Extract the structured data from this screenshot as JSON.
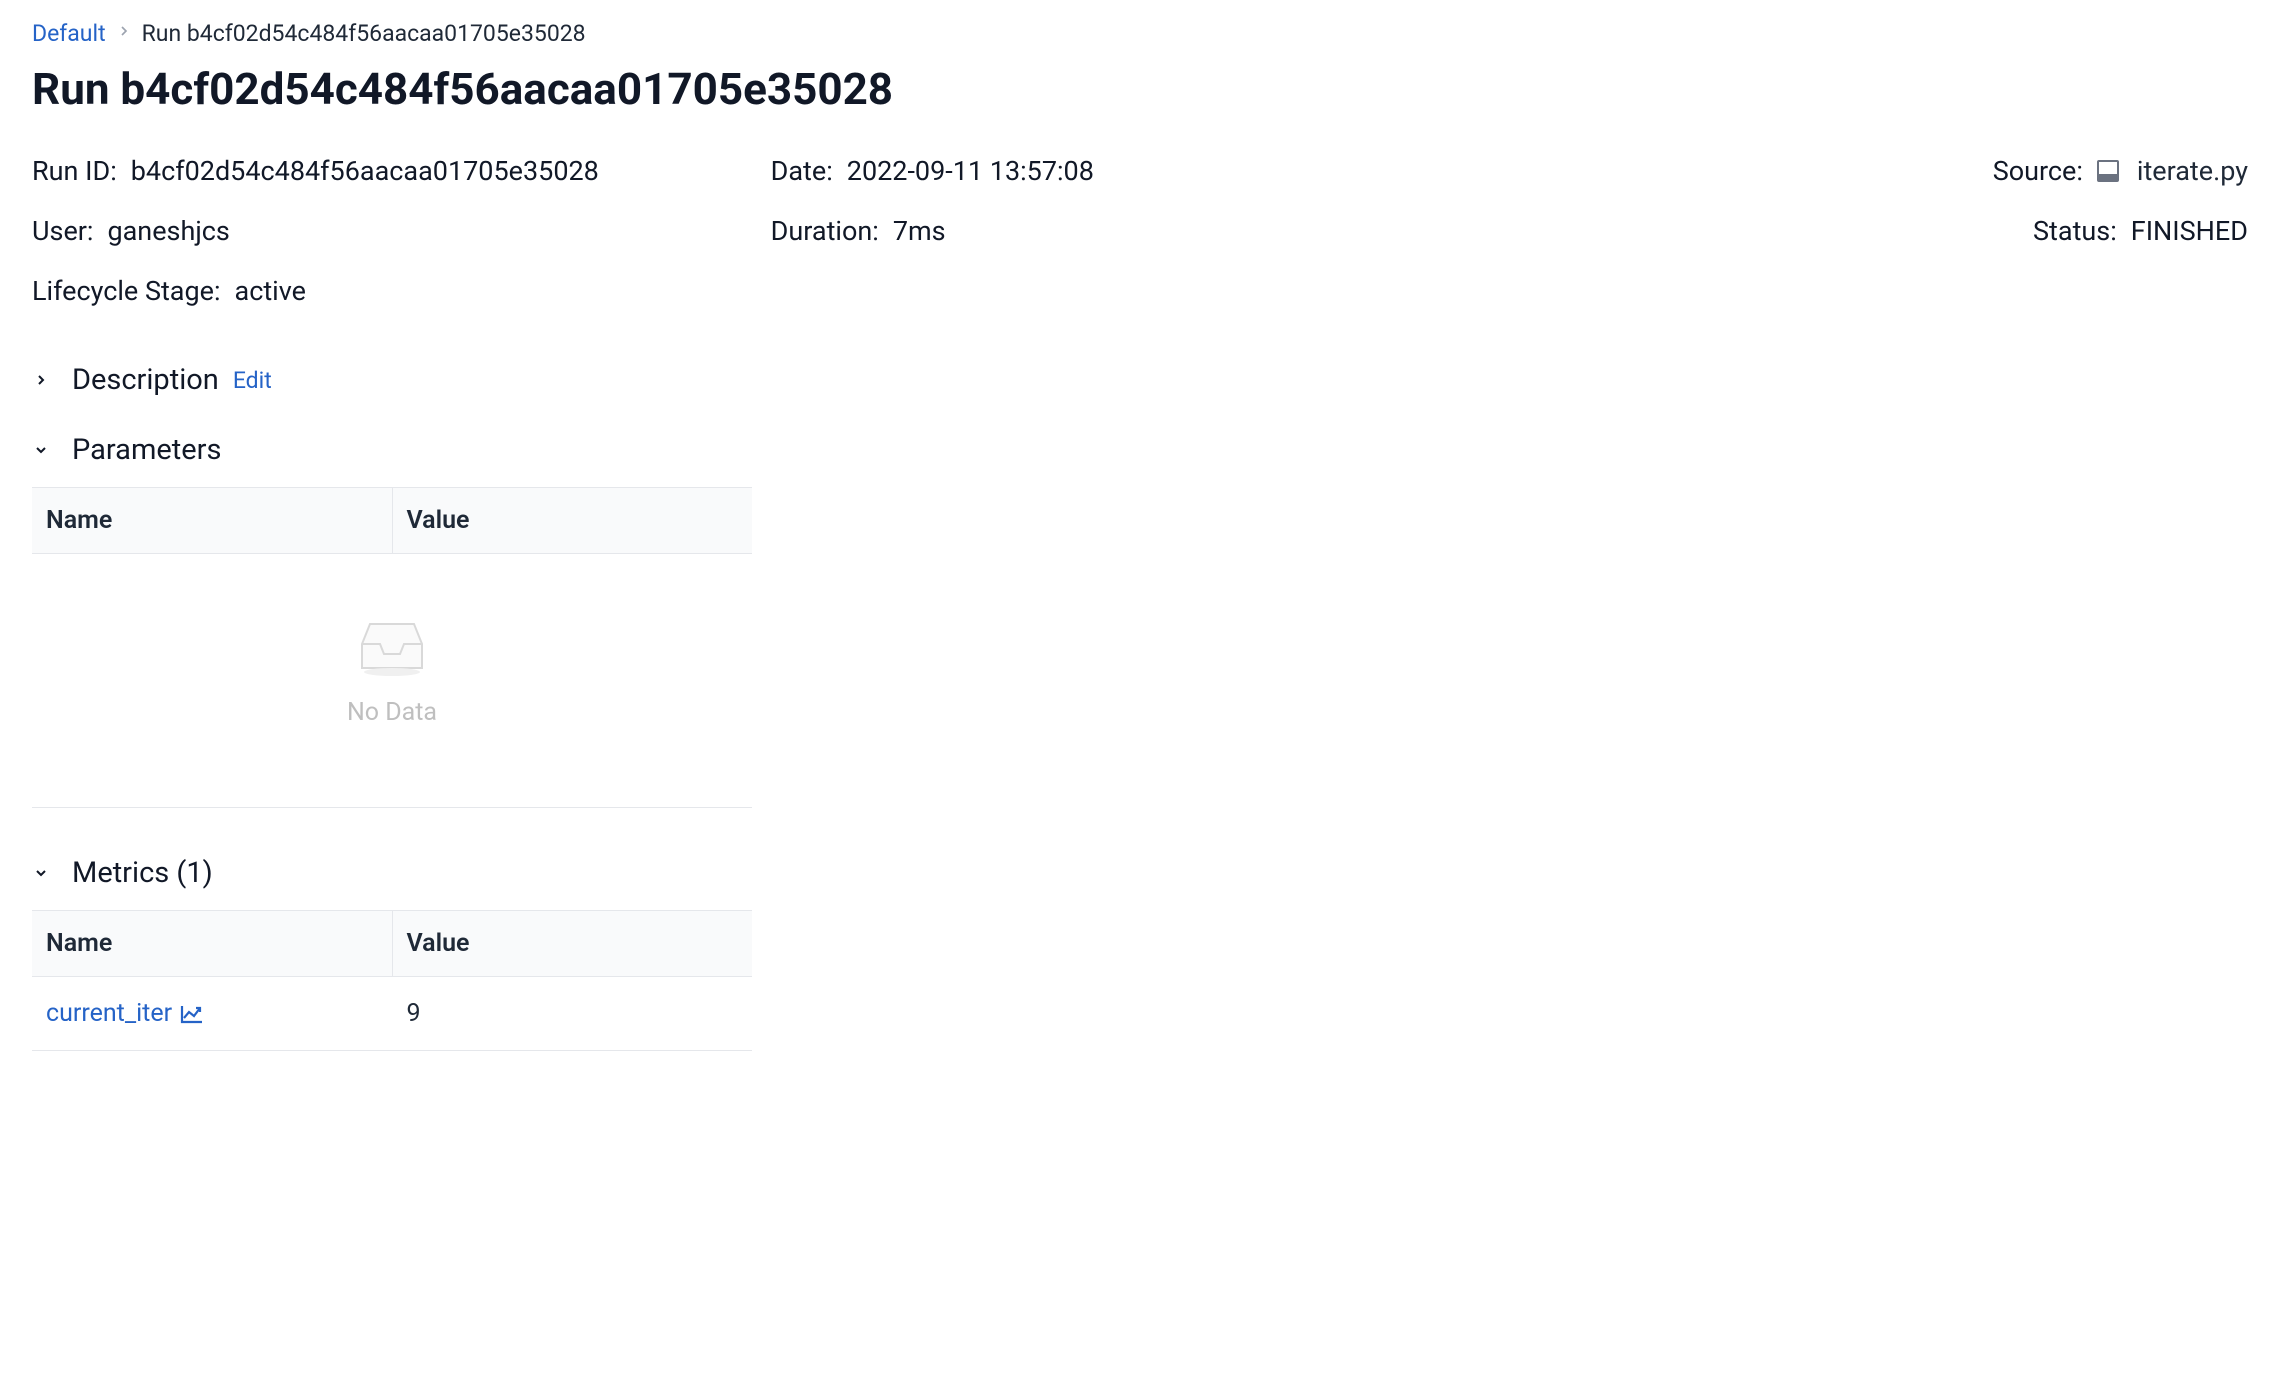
{
  "breadcrumb": {
    "root": "Default",
    "current": "Run b4cf02d54c484f56aacaa01705e35028"
  },
  "page_title": "Run b4cf02d54c484f56aacaa01705e35028",
  "info": {
    "run_id_label": "Run ID:",
    "run_id_value": "b4cf02d54c484f56aacaa01705e35028",
    "date_label": "Date:",
    "date_value": "2022-09-11 13:57:08",
    "source_label": "Source:",
    "source_value": "iterate.py",
    "user_label": "User:",
    "user_value": "ganeshjcs",
    "duration_label": "Duration:",
    "duration_value": "7ms",
    "status_label": "Status:",
    "status_value": "FINISHED",
    "lifecycle_label": "Lifecycle Stage:",
    "lifecycle_value": "active"
  },
  "sections": {
    "description": {
      "title": "Description",
      "edit_label": "Edit"
    },
    "parameters": {
      "title": "Parameters",
      "columns": {
        "name": "Name",
        "value": "Value"
      },
      "no_data": "No Data",
      "rows": []
    },
    "metrics": {
      "title": "Metrics (1)",
      "columns": {
        "name": "Name",
        "value": "Value"
      },
      "rows": [
        {
          "name": "current_iter",
          "value": "9"
        }
      ]
    }
  }
}
